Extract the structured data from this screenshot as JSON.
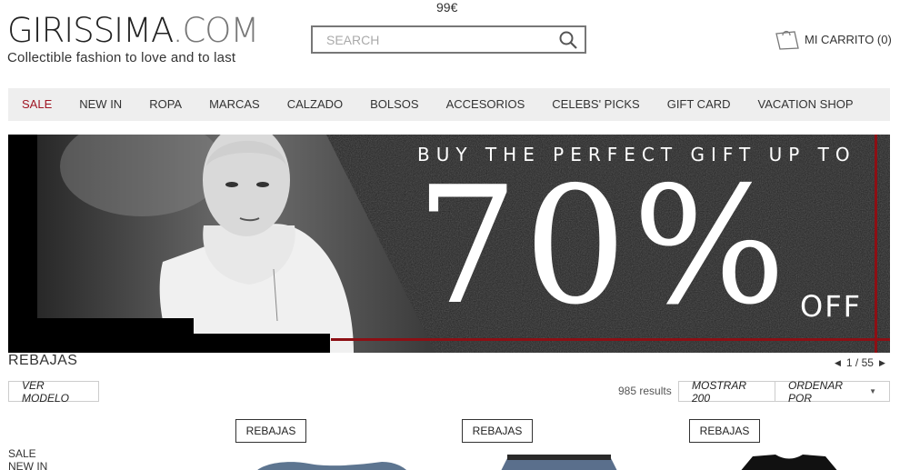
{
  "top_price": "99€",
  "logo": {
    "main_left": "GIRISSIMA",
    "main_right": ".COM",
    "tagline": "Collectible fashion to love and to last"
  },
  "search": {
    "placeholder": "SEARCH",
    "value": ""
  },
  "cart": {
    "label": "MI CARRITO (0)"
  },
  "nav": {
    "items": [
      "SALE",
      "NEW IN",
      "ROPA",
      "MARCAS",
      "CALZADO",
      "BOLSOS",
      "ACCESORIOS",
      "CELEBS' PICKS",
      "GIFT CARD",
      "VACATION SHOP"
    ]
  },
  "banner": {
    "line1": "BUY THE PERFECT GIFT UP TO",
    "big": "70%",
    "off": "OFF"
  },
  "section": {
    "title": "REBAJAS"
  },
  "pager": {
    "text": "1 / 55"
  },
  "filters": {
    "model_button": "VER MODELO",
    "results": "985 results",
    "show_button": "MOSTRAR 200",
    "order_button": "ORDENAR POR"
  },
  "sidebar": {
    "items": [
      "SALE",
      "NEW IN"
    ]
  },
  "products": {
    "badges": [
      "REBAJAS",
      "REBAJAS",
      "REBAJAS"
    ]
  },
  "colors": {
    "sale_red": "#a01624",
    "banner_red": "#8d0f14",
    "nav_bg": "#eeeeee"
  }
}
